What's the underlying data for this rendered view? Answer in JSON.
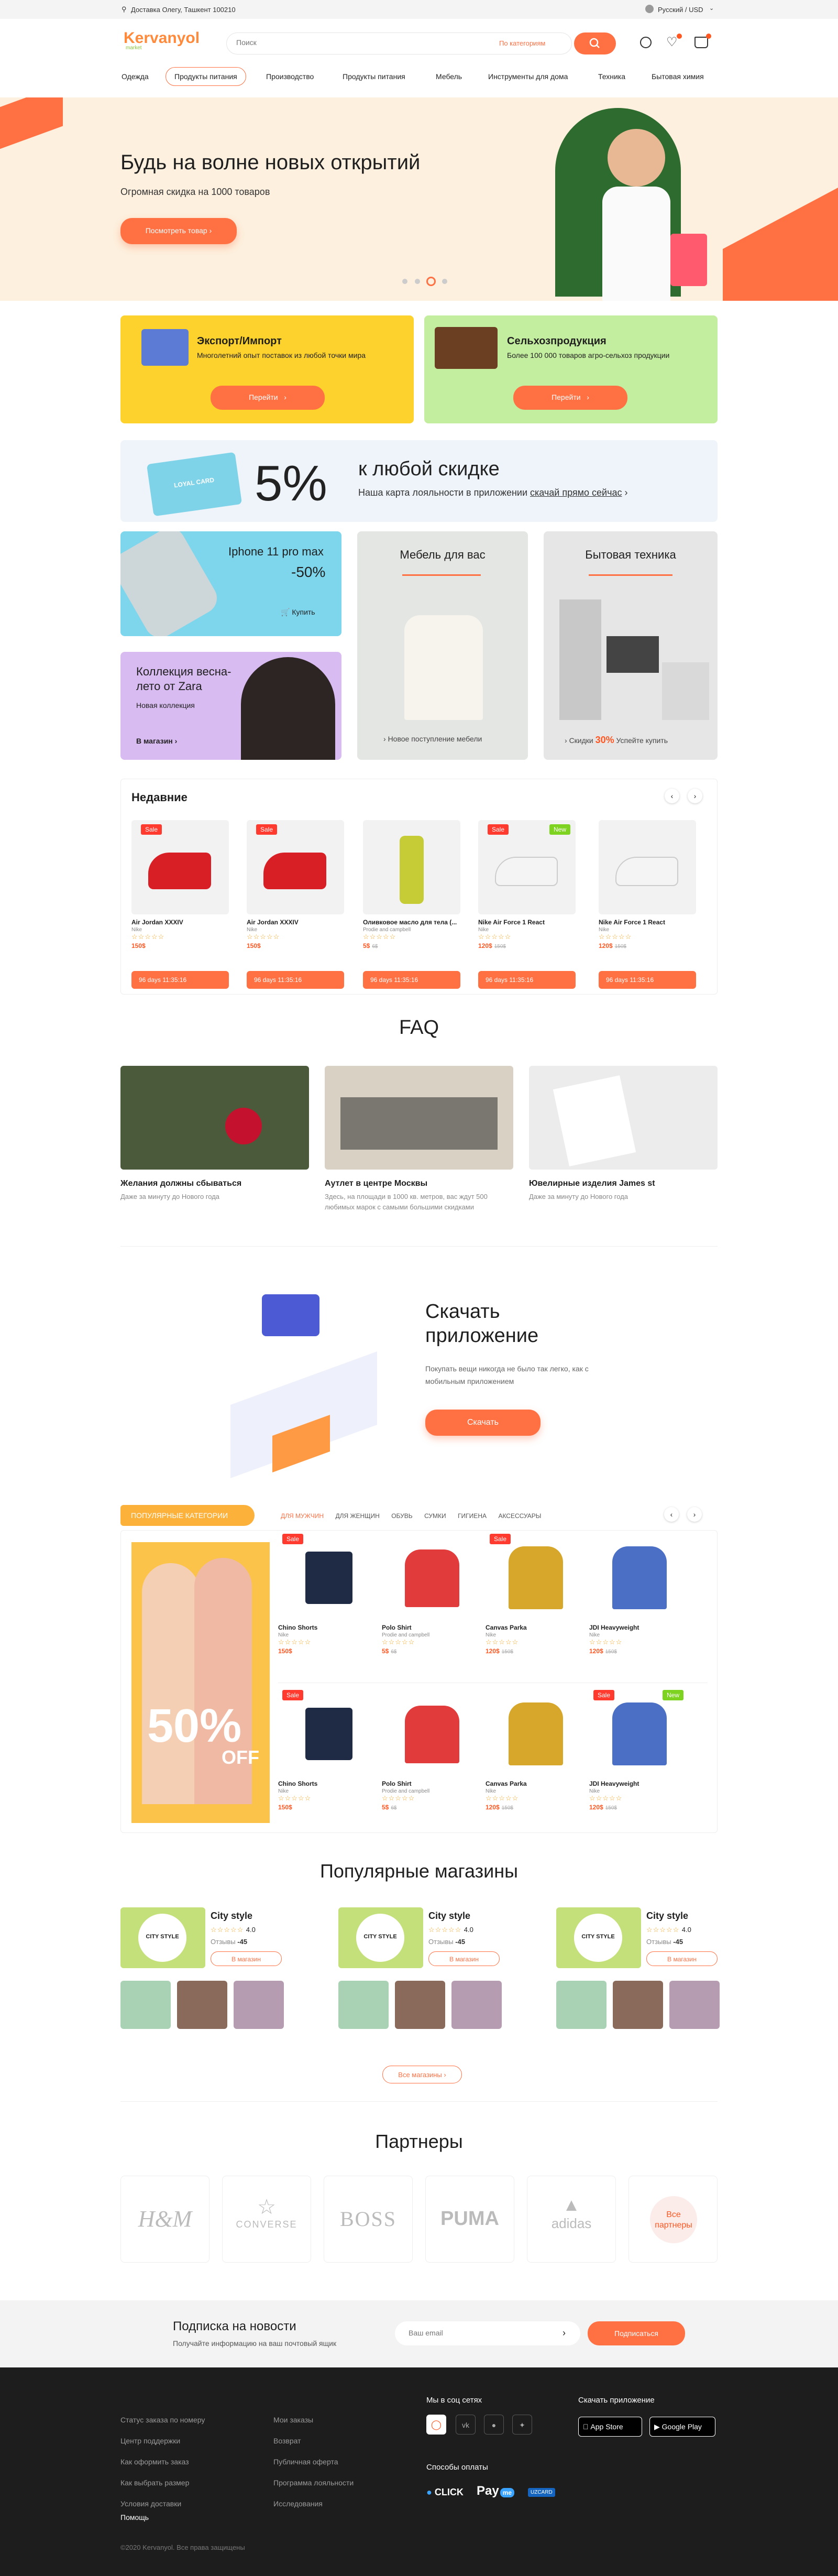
{
  "topbar": {
    "delivery": "Доставка Олегу, Ташкент 100210",
    "lang": "Русский / USD"
  },
  "header": {
    "logo": "Kervanyol",
    "logo_sub": "market",
    "search_placeholder": "Поиск",
    "category_select": "По категориям"
  },
  "nav": [
    "Одежда",
    "Продукты питания",
    "Производство",
    "Продукты питания",
    "Мебель",
    "Инструменты для дома",
    "Техника",
    "Бытовая химия"
  ],
  "hero": {
    "title": "Будь на волне новых открытий",
    "subtitle": "Огромная скидка на 1000 товаров",
    "button": "Посмотреть товар"
  },
  "promo_export": {
    "title": "Экспорт/Импорт",
    "text": "Многолетний опыт поставок из любой точки мира",
    "button": "Перейти"
  },
  "promo_agro": {
    "title": "Сельхозпродукция",
    "text": "Более 100 000 товаров агро-сельхоз продукции",
    "button": "Перейти"
  },
  "loyalty": {
    "percent": "5%",
    "title": "к любой скидке",
    "text": "Наша карта лояльности в приложении",
    "link": "скачай прямо сейчас",
    "card_text": "LOYAL CARD"
  },
  "tiles": {
    "iphone": {
      "title": "Iphone 11 pro max",
      "discount": "-50%",
      "button": "Купить"
    },
    "zara": {
      "title": "Коллекция весна-лето от Zara",
      "sub": "Новая коллекция",
      "button": "В магазин"
    },
    "furniture": {
      "title": "Мебель для вас",
      "footer": "Новое поступление мебели"
    },
    "appliances": {
      "title": "Бытовая техника",
      "footer_a": "Скидки",
      "footer_b": "30%",
      "footer_c": "Успейте купить"
    }
  },
  "recent": {
    "title": "Недавние",
    "items": [
      {
        "badge": "Sale",
        "title": "Air Jordan XXXIV",
        "sub": "Nike",
        "price": "150$",
        "old": "",
        "timer": "96 days 11:35:16"
      },
      {
        "badge": "Sale",
        "title": "Air Jordan XXXIV",
        "sub": "Nike",
        "price": "150$",
        "old": "",
        "timer": "96 days 11:35:16"
      },
      {
        "badge": "",
        "title": "Оливковое масло для тела (...",
        "sub": "Prodie and campbell",
        "price": "5$",
        "old": "6$",
        "timer": "96 days 11:35:16"
      },
      {
        "badge": "Sale",
        "badge2": "New",
        "title": "Nike Air Force 1 React",
        "sub": "Nike",
        "price": "120$",
        "old": "150$",
        "timer": "96 days 11:35:16"
      },
      {
        "badge": "",
        "title": "Nike Air Force 1 React",
        "sub": "Nike",
        "price": "120$",
        "old": "150$",
        "timer": "96 days 11:35:16"
      }
    ]
  },
  "faq": {
    "title": "FAQ",
    "items": [
      {
        "title": "Желания должны сбываться",
        "text": "Даже за минуту до Нового года"
      },
      {
        "title": "Аутлет в центре Москвы",
        "text": "Здесь, на площади в 1000 кв. метров, вас ждут 500 любимых марок с самыми большими скидками"
      },
      {
        "title": "Ювелирные изделия James st",
        "text": "Даже за минуту до Нового года"
      }
    ]
  },
  "app_promo": {
    "title_1": "Скачать",
    "title_2": "приложение",
    "text": "Покупать вещи никогда не было так легко, как с мобильным приложением",
    "button": "Скачать"
  },
  "categories": {
    "label": "ПОПУЛЯРНЫЕ КАТЕГОРИИ",
    "tabs": [
      "ДЛЯ МУЖЧИН",
      "ДЛЯ ЖЕНЩИН",
      "ОБУВЬ",
      "СУМКИ",
      "ГИГИЕНА",
      "АКСЕССУАРЫ"
    ],
    "banner": "50%",
    "banner_off": "OFF",
    "items": [
      {
        "badge": "Sale",
        "title": "Chino Shorts",
        "sub": "Nike",
        "price": "150$",
        "old": ""
      },
      {
        "badge": "",
        "title": "Polo Shirt",
        "sub": "Prodie and campbell",
        "price": "5$",
        "old": "6$"
      },
      {
        "badge": "Sale",
        "title": "Canvas Parka",
        "sub": "Nike",
        "price": "120$",
        "old": "150$"
      },
      {
        "badge": "",
        "title": "JDI Heavyweight",
        "sub": "Nike",
        "price": "120$",
        "old": "150$"
      },
      {
        "badge": "Sale",
        "title": "Chino Shorts",
        "sub": "Nike",
        "price": "150$",
        "old": ""
      },
      {
        "badge": "",
        "title": "Polo Shirt",
        "sub": "Prodie and campbell",
        "price": "5$",
        "old": "6$"
      },
      {
        "badge": "",
        "title": "Canvas Parka",
        "sub": "Nike",
        "price": "120$",
        "old": "150$"
      },
      {
        "badge": "Sale",
        "badge2": "New",
        "title": "JDI Heavyweight",
        "sub": "Nike",
        "price": "120$",
        "old": "150$"
      }
    ]
  },
  "shops": {
    "title": "Популярные магазины",
    "items": [
      {
        "name": "City style",
        "rating": "4.0",
        "reviews_label": "Отзывы",
        "reviews": "45",
        "button": "В магазин",
        "logo": "CITY STYLE"
      },
      {
        "name": "City style",
        "rating": "4.0",
        "reviews_label": "Отзывы",
        "reviews": "45",
        "button": "В магазин",
        "logo": "CITY STYLE"
      },
      {
        "name": "City style",
        "rating": "4.0",
        "reviews_label": "Отзывы",
        "reviews": "45",
        "button": "В магазин",
        "logo": "CITY STYLE"
      }
    ],
    "all_button": "Все магазины"
  },
  "partners": {
    "title": "Партнеры",
    "items": [
      "H&M",
      "CONVERSE",
      "BOSS",
      "PUMA",
      "adidas"
    ],
    "all": "Все партнеры"
  },
  "newsletter": {
    "title": "Подписка на новости",
    "text": "Получайте информацию на ваш почтовый ящик",
    "placeholder": "Ваш email",
    "button": "Подписаться"
  },
  "footer": {
    "col1": [
      "Статус заказа по номеру",
      "Центр поддержки",
      "Как оформить заказ",
      "Как выбрать размер",
      "Условия доставки",
      "Помощь"
    ],
    "col2": [
      "Мои заказы",
      "Возврат",
      "Публичная оферта",
      "Программа лояльности",
      "Исследования"
    ],
    "social_title": "Мы в соц сетях",
    "pay_title": "Способы оплаты",
    "app_title": "Скачать приложение",
    "app_store": "App Store",
    "google_play": "Google Play",
    "pay": [
      "CLICK",
      "Pay",
      "UZCARD"
    ],
    "copyright": "©2020 Kervanyol. Все права защищены"
  },
  "colors": {
    "accent": "#ff7043",
    "yellow": "#fdd22d",
    "green": "#c4ee9f",
    "dark": "#1d1d1d"
  }
}
